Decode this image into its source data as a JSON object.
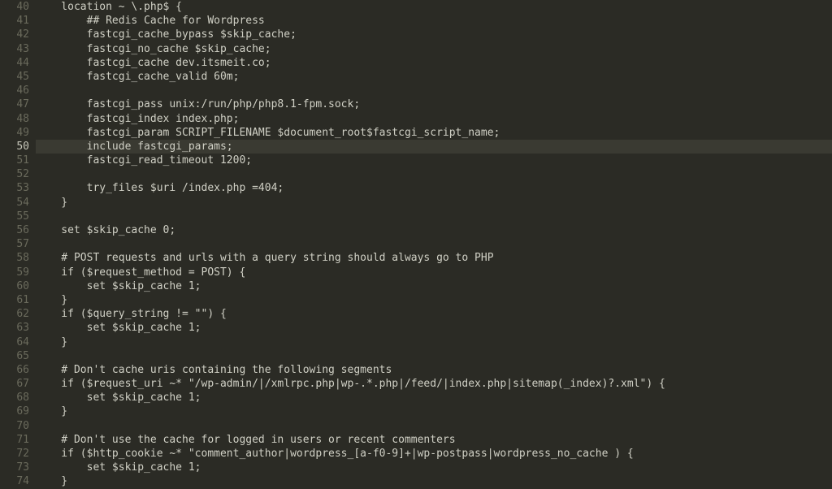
{
  "editor": {
    "startLine": 40,
    "currentLine": 50,
    "lines": [
      "    location ~ \\.php$ {",
      "        ## Redis Cache for Wordpress",
      "        fastcgi_cache_bypass $skip_cache;",
      "        fastcgi_no_cache $skip_cache;",
      "        fastcgi_cache dev.itsmeit.co;",
      "        fastcgi_cache_valid 60m;",
      "",
      "        fastcgi_pass unix:/run/php/php8.1-fpm.sock;",
      "        fastcgi_index index.php;",
      "        fastcgi_param SCRIPT_FILENAME $document_root$fastcgi_script_name;",
      "        include fastcgi_params;",
      "        fastcgi_read_timeout 1200;",
      "",
      "        try_files $uri /index.php =404;",
      "    }",
      "",
      "    set $skip_cache 0;",
      "",
      "    # POST requests and urls with a query string should always go to PHP",
      "    if ($request_method = POST) {",
      "        set $skip_cache 1;",
      "    }",
      "    if ($query_string != \"\") {",
      "        set $skip_cache 1;",
      "    }",
      "",
      "    # Don't cache uris containing the following segments",
      "    if ($request_uri ~* \"/wp-admin/|/xmlrpc.php|wp-.*.php|/feed/|index.php|sitemap(_index)?.xml\") {",
      "        set $skip_cache 1;",
      "    }",
      "",
      "    # Don't use the cache for logged in users or recent commenters",
      "    if ($http_cookie ~* \"comment_author|wordpress_[a-f0-9]+|wp-postpass|wordpress_no_cache ) {",
      "        set $skip_cache 1;",
      "    }"
    ]
  }
}
